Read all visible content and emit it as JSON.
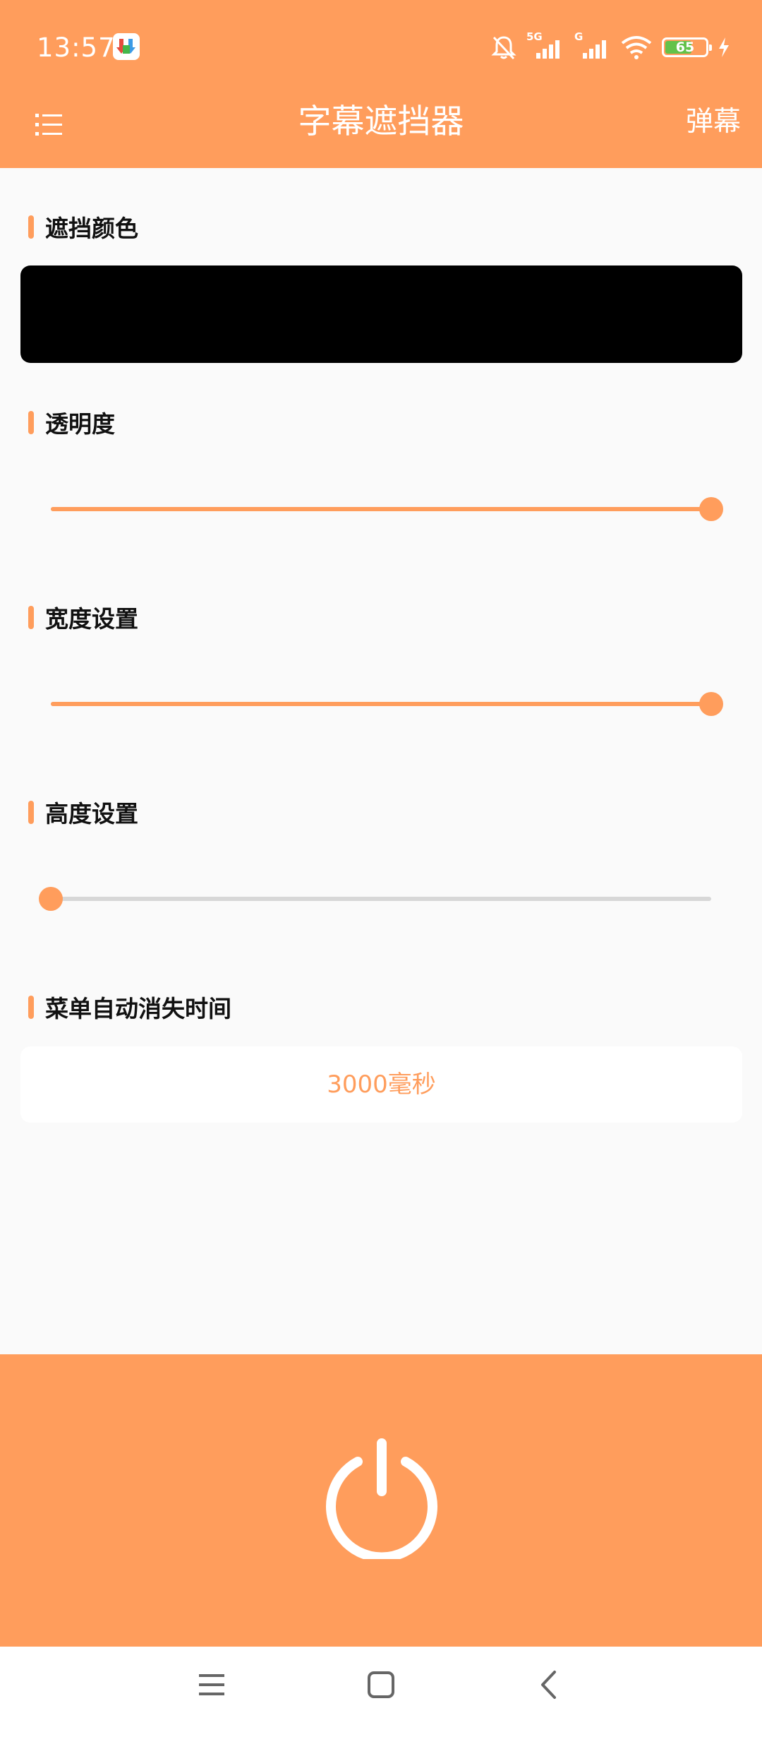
{
  "status_bar": {
    "time": "13:57",
    "network_1": "5G",
    "network_2": "G",
    "battery_level": "65",
    "icons": [
      "app-notification-icon",
      "bell-off-icon",
      "signal-5g-icon",
      "signal-g-icon",
      "wifi-icon",
      "battery-icon",
      "charging-icon"
    ]
  },
  "app_bar": {
    "title": "字幕遮挡器",
    "right_action": "弹幕"
  },
  "settings": {
    "color": {
      "label": "遮挡颜色",
      "value": "#000000"
    },
    "opacity": {
      "label": "透明度",
      "value": 1.0
    },
    "width": {
      "label": "宽度设置",
      "value": 1.0
    },
    "height": {
      "label": "高度设置",
      "value": 0.0
    },
    "menu_timeout": {
      "label": "菜单自动消失时间",
      "value": "3000毫秒"
    }
  },
  "colors": {
    "accent": "#FF9D5C",
    "background": "#FAFAFA",
    "track_inactive": "#D7D7D7"
  }
}
